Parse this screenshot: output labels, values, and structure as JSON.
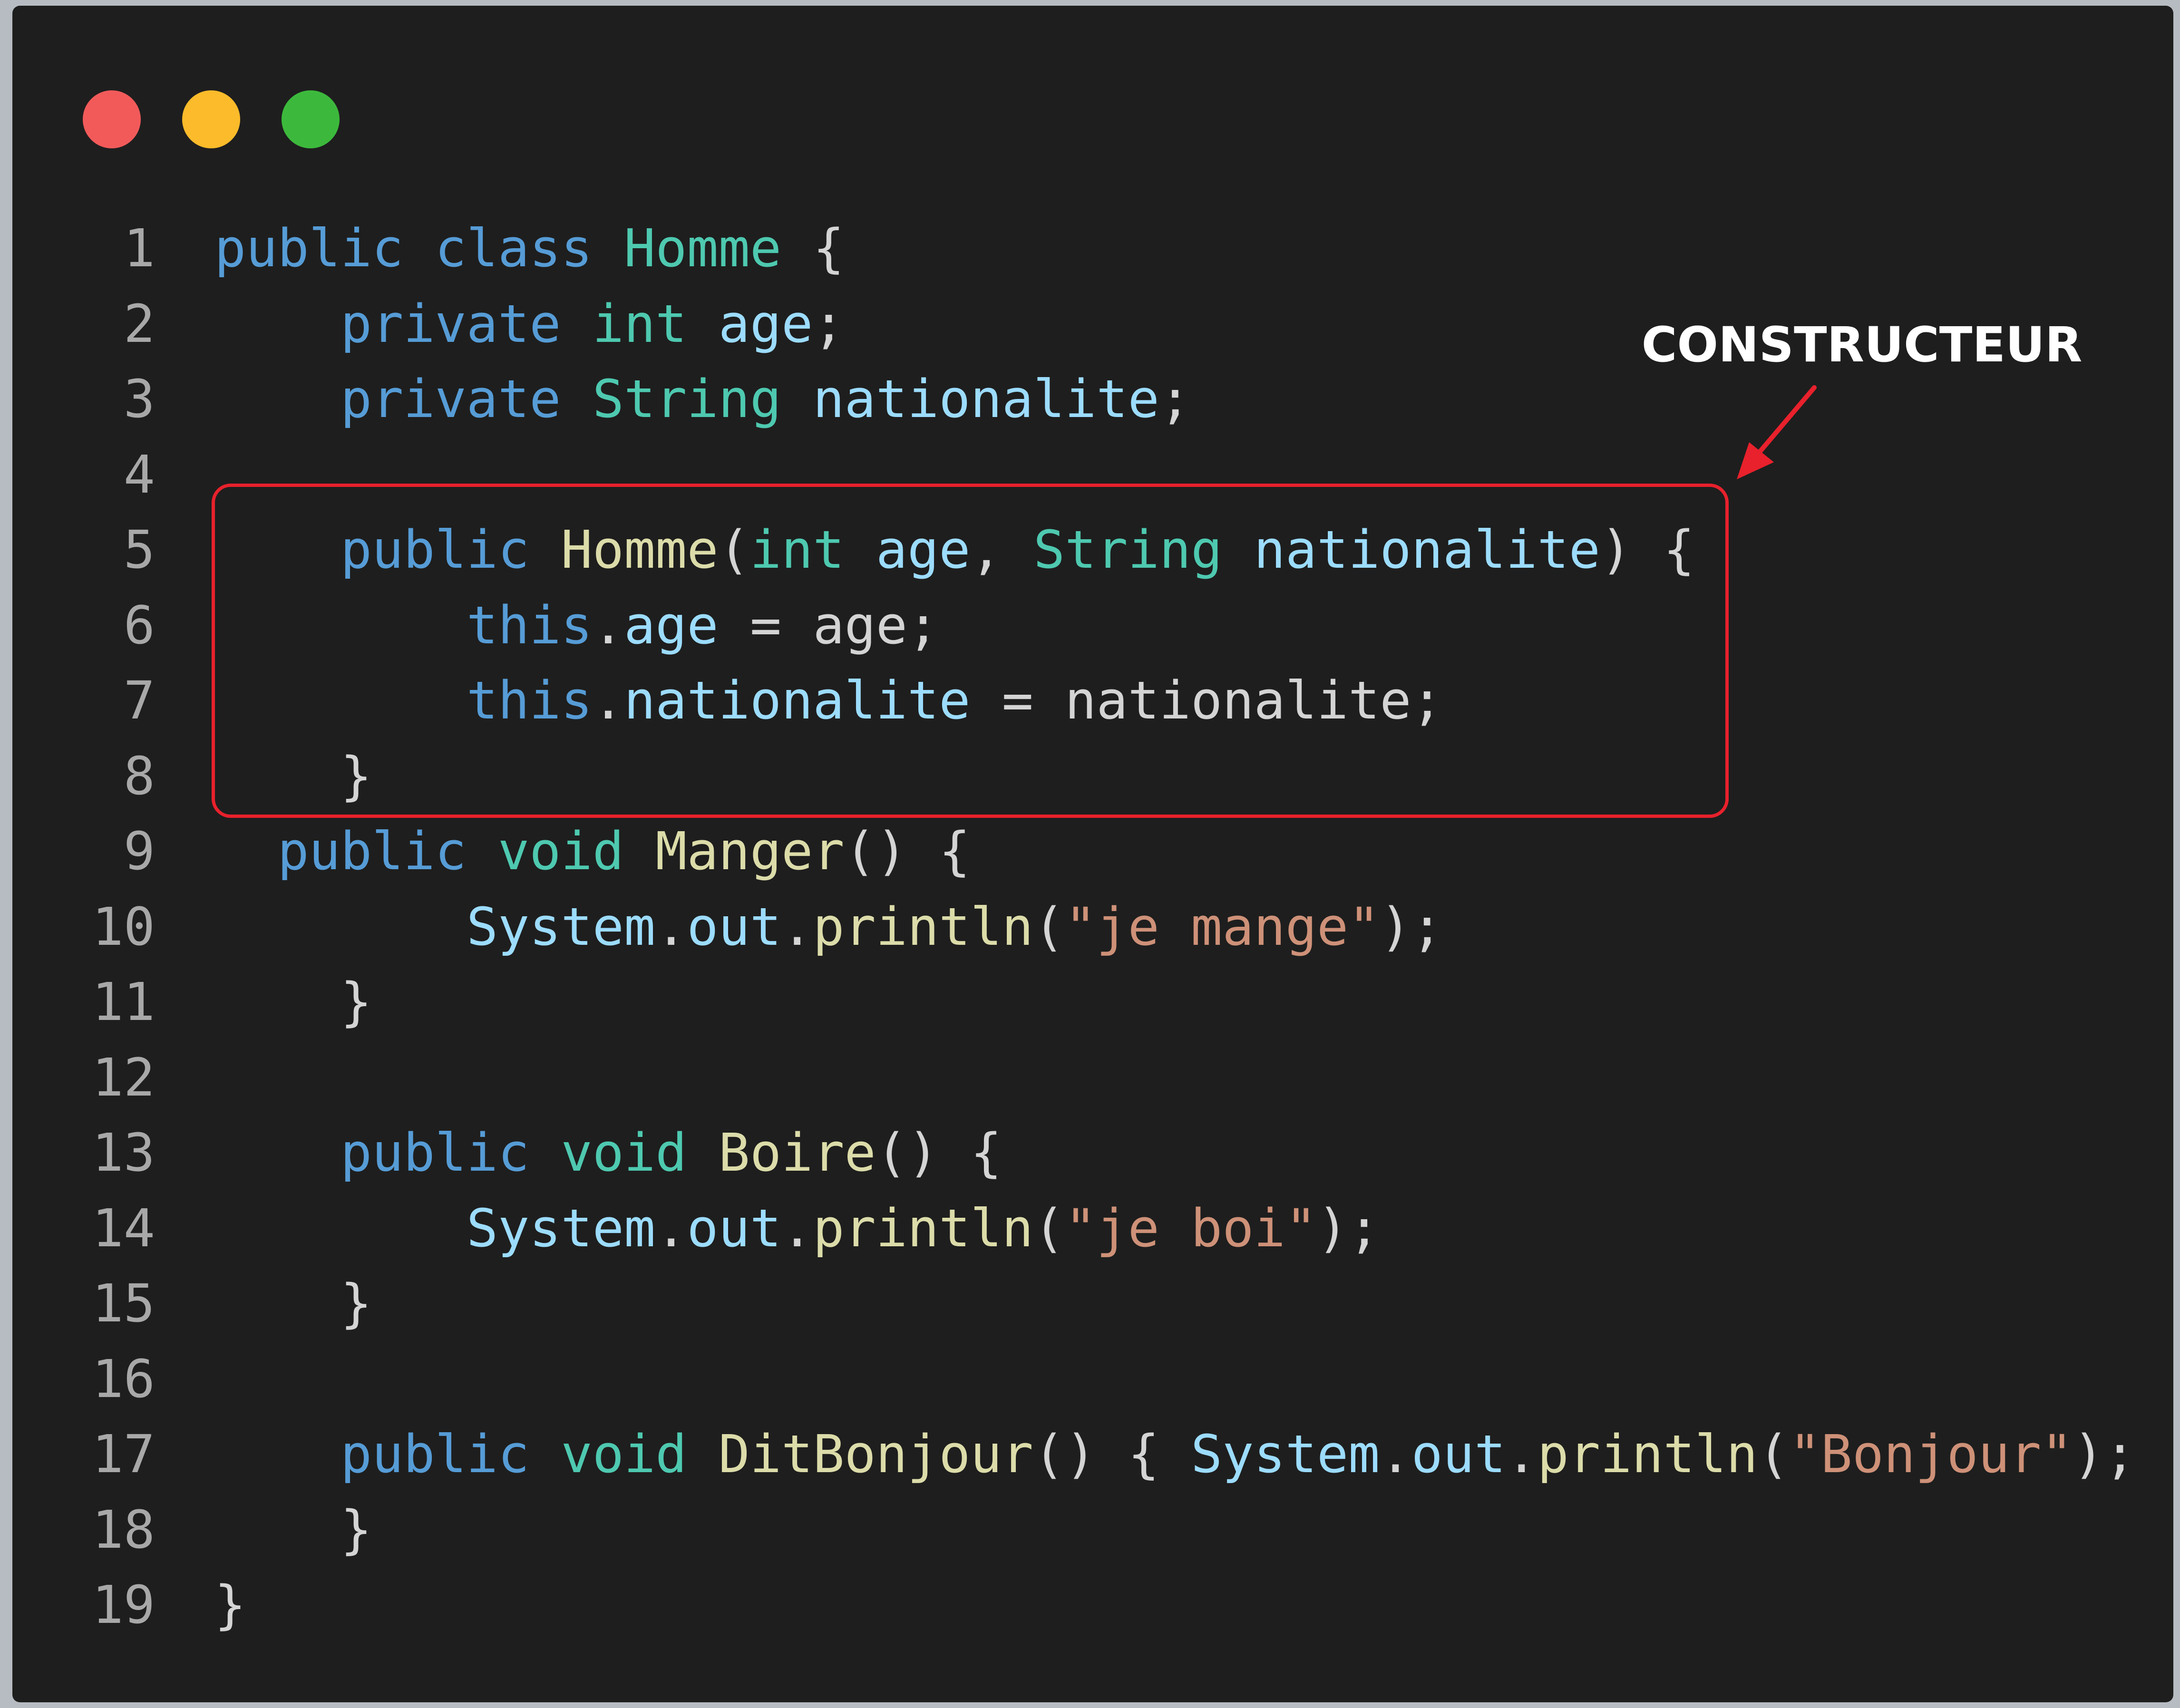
{
  "window_controls": [
    "close",
    "minimize",
    "maximize"
  ],
  "annotation": {
    "label": "CONSTRUCTEUR",
    "color": "#e8212c"
  },
  "colors": {
    "background": "#1e1e1e",
    "keyword": "#569cd6",
    "type": "#4ec9b0",
    "variable": "#9cdcfe",
    "function": "#dcdcaa",
    "string": "#ce9178",
    "plain": "#d4d4d4",
    "line_number": "#a8a8a8"
  },
  "lines": [
    {
      "n": "1",
      "t": [
        [
          "k",
          "public"
        ],
        [
          "p",
          " "
        ],
        [
          "k",
          "class"
        ],
        [
          "p",
          " "
        ],
        [
          "c",
          "Homme"
        ],
        [
          "p",
          " {"
        ]
      ]
    },
    {
      "n": "2",
      "t": [
        [
          "p",
          "    "
        ],
        [
          "k",
          "private"
        ],
        [
          "p",
          " "
        ],
        [
          "c",
          "int"
        ],
        [
          "p",
          " "
        ],
        [
          "v",
          "age"
        ],
        [
          "p",
          ";"
        ]
      ]
    },
    {
      "n": "3",
      "t": [
        [
          "p",
          "    "
        ],
        [
          "k",
          "private"
        ],
        [
          "p",
          " "
        ],
        [
          "c",
          "String"
        ],
        [
          "p",
          " "
        ],
        [
          "v",
          "nationalite"
        ],
        [
          "p",
          ";"
        ]
      ]
    },
    {
      "n": "4",
      "t": []
    },
    {
      "n": "5",
      "t": [
        [
          "p",
          "    "
        ],
        [
          "k",
          "public"
        ],
        [
          "p",
          " "
        ],
        [
          "f",
          "Homme"
        ],
        [
          "p",
          "("
        ],
        [
          "c",
          "int"
        ],
        [
          "p",
          " "
        ],
        [
          "v",
          "age"
        ],
        [
          "p",
          ", "
        ],
        [
          "c",
          "String"
        ],
        [
          "p",
          " "
        ],
        [
          "v",
          "nationalite"
        ],
        [
          "p",
          ") {"
        ]
      ]
    },
    {
      "n": "6",
      "t": [
        [
          "p",
          "        "
        ],
        [
          "k",
          "this"
        ],
        [
          "p",
          "."
        ],
        [
          "v",
          "age"
        ],
        [
          "p",
          " = "
        ],
        [
          "p",
          "age"
        ],
        [
          "p",
          ";"
        ]
      ]
    },
    {
      "n": "7",
      "t": [
        [
          "p",
          "        "
        ],
        [
          "k",
          "this"
        ],
        [
          "p",
          "."
        ],
        [
          "v",
          "nationalite"
        ],
        [
          "p",
          " = "
        ],
        [
          "p",
          "nationalite"
        ],
        [
          "p",
          ";"
        ]
      ]
    },
    {
      "n": "8",
      "t": [
        [
          "p",
          "    }"
        ]
      ]
    },
    {
      "n": "9",
      "t": [
        [
          "p",
          "  "
        ],
        [
          "k",
          "public"
        ],
        [
          "p",
          " "
        ],
        [
          "c",
          "void"
        ],
        [
          "p",
          " "
        ],
        [
          "f",
          "Manger"
        ],
        [
          "p",
          "() {"
        ]
      ]
    },
    {
      "n": "10",
      "t": [
        [
          "p",
          "        "
        ],
        [
          "v",
          "System"
        ],
        [
          "p",
          "."
        ],
        [
          "v",
          "out"
        ],
        [
          "p",
          "."
        ],
        [
          "f",
          "println"
        ],
        [
          "p",
          "("
        ],
        [
          "s",
          "\"je mange\""
        ],
        [
          "p",
          ");"
        ]
      ]
    },
    {
      "n": "11",
      "t": [
        [
          "p",
          "    }"
        ]
      ]
    },
    {
      "n": "12",
      "t": []
    },
    {
      "n": "13",
      "t": [
        [
          "p",
          "    "
        ],
        [
          "k",
          "public"
        ],
        [
          "p",
          " "
        ],
        [
          "c",
          "void"
        ],
        [
          "p",
          " "
        ],
        [
          "f",
          "Boire"
        ],
        [
          "p",
          "() {"
        ]
      ]
    },
    {
      "n": "14",
      "t": [
        [
          "p",
          "        "
        ],
        [
          "v",
          "System"
        ],
        [
          "p",
          "."
        ],
        [
          "v",
          "out"
        ],
        [
          "p",
          "."
        ],
        [
          "f",
          "println"
        ],
        [
          "p",
          "("
        ],
        [
          "s",
          "\"je boi\""
        ],
        [
          "p",
          ");"
        ]
      ]
    },
    {
      "n": "15",
      "t": [
        [
          "p",
          "    }"
        ]
      ]
    },
    {
      "n": "16",
      "t": []
    },
    {
      "n": "17",
      "t": [
        [
          "p",
          "    "
        ],
        [
          "k",
          "public"
        ],
        [
          "p",
          " "
        ],
        [
          "c",
          "void"
        ],
        [
          "p",
          " "
        ],
        [
          "f",
          "DitBonjour"
        ],
        [
          "p",
          "() { "
        ],
        [
          "v",
          "System"
        ],
        [
          "p",
          "."
        ],
        [
          "v",
          "out"
        ],
        [
          "p",
          "."
        ],
        [
          "f",
          "println"
        ],
        [
          "p",
          "("
        ],
        [
          "s",
          "\"Bonjour\""
        ],
        [
          "p",
          ");"
        ]
      ]
    },
    {
      "n": "18",
      "t": [
        [
          "p",
          "    }"
        ]
      ]
    },
    {
      "n": "19",
      "t": [
        [
          "p",
          "}"
        ]
      ]
    }
  ]
}
